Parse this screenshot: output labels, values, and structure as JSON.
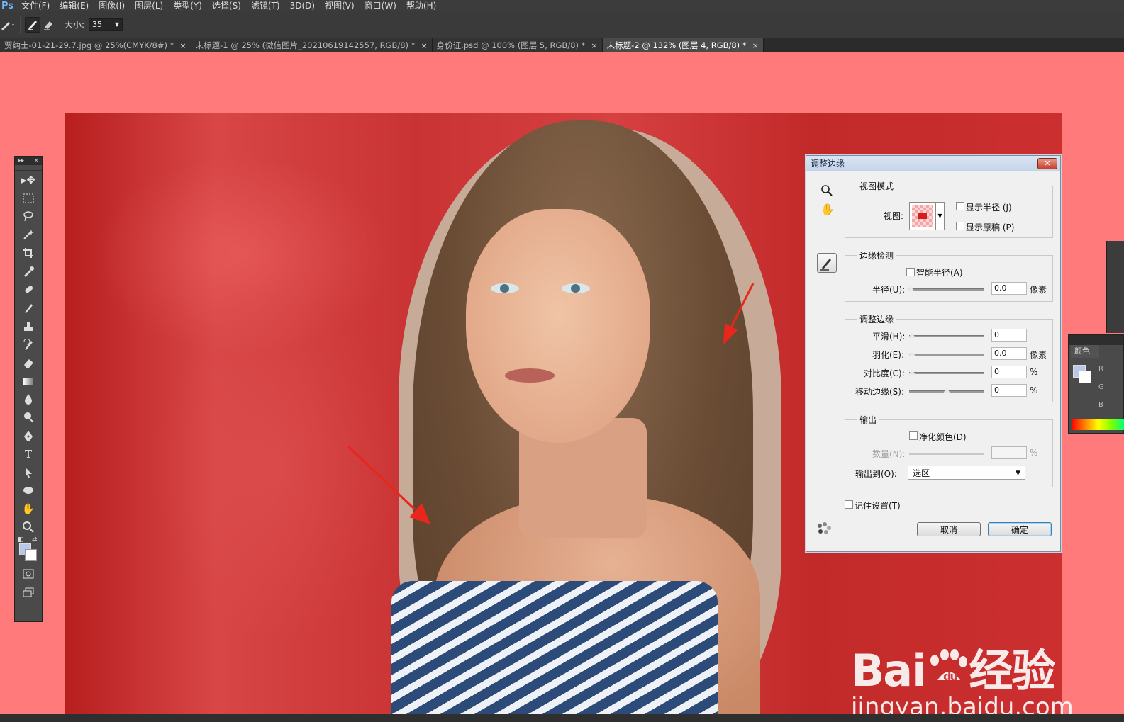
{
  "menubar": {
    "logo": "Ps",
    "items": [
      "文件(F)",
      "编辑(E)",
      "图像(I)",
      "图层(L)",
      "类型(Y)",
      "选择(S)",
      "滤镜(T)",
      "3D(D)",
      "视图(V)",
      "窗口(W)",
      "帮助(H)"
    ]
  },
  "options": {
    "size_label": "大小:",
    "size_value": "35"
  },
  "tabs": [
    {
      "label": "贾纳士-01-21-29.7.jpg @ 25%(CMYK/8#) *",
      "close": "×"
    },
    {
      "label": "未标题-1 @ 25% (微信图片_20210619142557, RGB/8) *",
      "close": "×"
    },
    {
      "label": "身份证.psd @ 100% (图层 5, RGB/8) *",
      "close": "×"
    },
    {
      "label": "未标题-2 @ 132% (图层 4, RGB/8) *",
      "close": "×"
    }
  ],
  "watermark": {
    "brand_left": "Bai",
    "brand_right": "经验",
    "url": "jingyan.baidu.com"
  },
  "dialog": {
    "title": "调整边缘",
    "close": "✕",
    "view_mode": {
      "legend": "视图模式",
      "view_label": "视图:",
      "show_radius": "显示半径 (J)",
      "show_original": "显示原稿 (P)"
    },
    "edge_detection": {
      "legend": "边缘检测",
      "smart_radius": "智能半径(A)",
      "radius_label": "半径(U):",
      "radius_value": "0.0",
      "radius_unit": "像素"
    },
    "adjust_edge": {
      "legend": "调整边缘",
      "smooth_label": "平滑(H):",
      "smooth_value": "0",
      "feather_label": "羽化(E):",
      "feather_value": "0.0",
      "feather_unit": "像素",
      "contrast_label": "对比度(C):",
      "contrast_value": "0",
      "contrast_unit": "%",
      "shift_label": "移动边缘(S):",
      "shift_value": "0",
      "shift_unit": "%"
    },
    "output": {
      "legend": "输出",
      "decontaminate": "净化颜色(D)",
      "amount_label": "数量(N):",
      "amount_value": "",
      "amount_unit": "%",
      "output_to_label": "输出到(O):",
      "output_to_value": "选区"
    },
    "remember": "记住设置(T)",
    "cancel": "取消",
    "ok": "确定"
  },
  "color_panel": {
    "tab": "颜色",
    "channels": [
      "R",
      "G",
      "B"
    ]
  },
  "colors": {
    "canvas_bg": "#ff7b7b",
    "foreground": "#b9c8e6",
    "background": "#ffffff",
    "arrow": "#e8261c"
  }
}
